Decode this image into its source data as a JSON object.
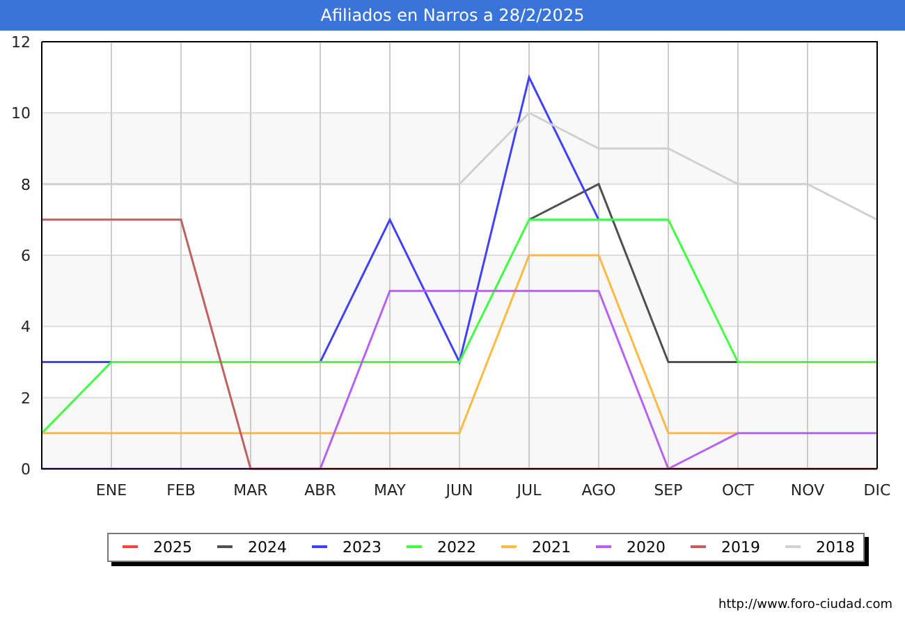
{
  "chart_data": {
    "type": "line",
    "title": "Afiliados en Narros a 28/2/2025",
    "categories": [
      null,
      "ENE",
      "FEB",
      "MAR",
      "ABR",
      "MAY",
      "JUN",
      "JUL",
      "AGO",
      "SEP",
      "OCT",
      "NOV",
      "DIC"
    ],
    "ylim": [
      0,
      12
    ],
    "grid": true,
    "yticks": [
      0,
      2,
      4,
      6,
      8,
      10,
      12
    ],
    "series": [
      {
        "name": "2025",
        "color": "#ff4040",
        "values": [
          null,
          null,
          null,
          null,
          null,
          null,
          null,
          null,
          null,
          null,
          null,
          null,
          null
        ]
      },
      {
        "name": "2024",
        "color": "#505050",
        "values": [
          null,
          null,
          null,
          null,
          null,
          null,
          null,
          7,
          8,
          3,
          3,
          null,
          null
        ]
      },
      {
        "name": "2023",
        "color": "#4040ff",
        "values": [
          3,
          3,
          null,
          null,
          3,
          7,
          3,
          11,
          7,
          null,
          null,
          null,
          null
        ]
      },
      {
        "name": "2022",
        "color": "#40ff40",
        "values": [
          1,
          3,
          3,
          3,
          3,
          3,
          3,
          7,
          7,
          7,
          3,
          3,
          3
        ]
      },
      {
        "name": "2021",
        "color": "#ffb840",
        "values": [
          1,
          1,
          1,
          1,
          1,
          1,
          1,
          6,
          6,
          1,
          1,
          null,
          null
        ]
      },
      {
        "name": "2020",
        "color": "#b860f0",
        "values": [
          0,
          0,
          0,
          0,
          0,
          5,
          5,
          5,
          5,
          0,
          1,
          1,
          1
        ]
      },
      {
        "name": "2019",
        "color": "#c06060",
        "values": [
          7,
          7,
          7,
          0,
          0,
          0,
          0,
          0,
          0,
          0,
          0,
          0,
          0
        ]
      },
      {
        "name": "2018",
        "color": "#d0d0d0",
        "values": [
          8,
          8,
          8,
          8,
          8,
          8,
          8,
          10,
          9,
          9,
          8,
          8,
          7
        ]
      }
    ]
  },
  "source": "http://www.foro-ciudad.com"
}
